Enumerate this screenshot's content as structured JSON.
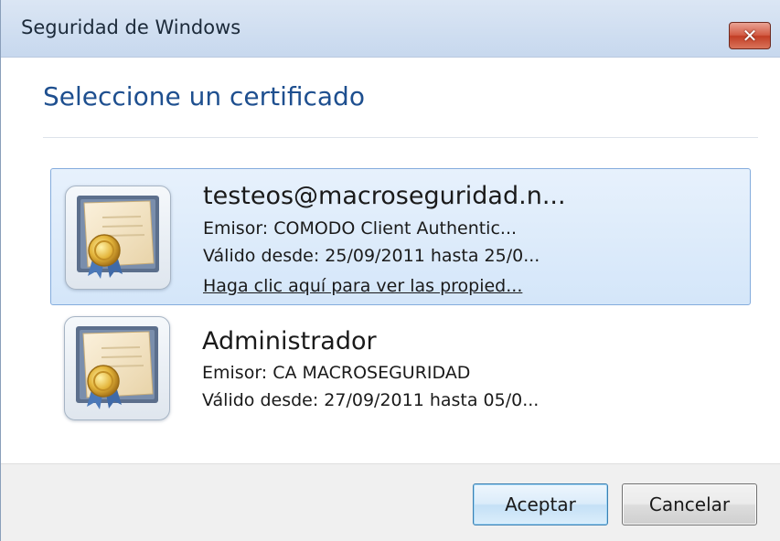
{
  "window": {
    "title": "Seguridad de Windows",
    "close_glyph": "✕"
  },
  "dialog": {
    "heading": "Seleccione un certificado"
  },
  "certificates": [
    {
      "name": "testeos@macroseguridad.n...",
      "issuer": "Emisor: COMODO Client Authentic...",
      "validity": "Válido desde: 25/09/2011 hasta 25/0...",
      "link": "Haga clic aquí para ver las propied...",
      "selected": true,
      "icon": "certificate-icon"
    },
    {
      "name": "Administrador",
      "issuer": "Emisor: CA MACROSEGURIDAD",
      "validity": "Válido desde: 27/09/2011 hasta 05/0...",
      "selected": false,
      "icon": "certificate-icon"
    }
  ],
  "buttons": {
    "ok": "Aceptar",
    "cancel": "Cancelar"
  },
  "colors": {
    "heading": "#1e4f8f",
    "selection_bg": "#dbe9f9",
    "selection_border": "#84acdd"
  }
}
